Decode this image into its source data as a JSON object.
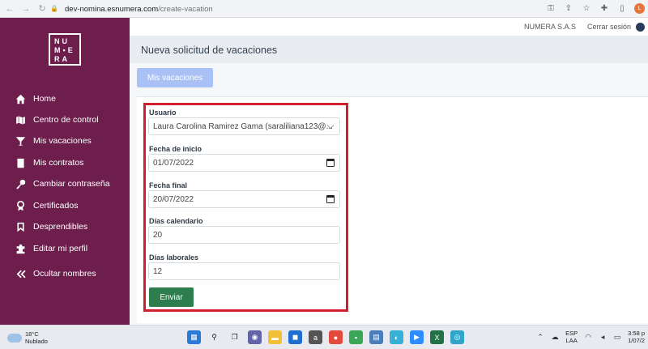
{
  "browser": {
    "url_host": "dev-nomina.esnumera.com",
    "url_path": "/create-vacation",
    "profile_initial": "L"
  },
  "sidebar": {
    "logo": [
      "NU",
      "M▪E",
      "RA"
    ],
    "items": [
      {
        "label": "Home",
        "icon": "home-icon"
      },
      {
        "label": "Centro de control",
        "icon": "map-icon"
      },
      {
        "label": "Mis vacaciones",
        "icon": "cocktail-icon"
      },
      {
        "label": "Mis contratos",
        "icon": "book-icon"
      },
      {
        "label": "Cambiar contraseña",
        "icon": "key-icon"
      },
      {
        "label": "Certificados",
        "icon": "award-icon"
      },
      {
        "label": "Desprendibles",
        "icon": "bookmark-icon"
      },
      {
        "label": "Editar mi perfil",
        "icon": "puzzle-icon"
      },
      {
        "label": "Ocultar nombres",
        "icon": "double-chevron-left-icon"
      }
    ]
  },
  "topbar": {
    "company": "NUMERA S.A.S",
    "logout": "Cerrar sesión"
  },
  "page": {
    "title": "Nueva solicitud de vacaciones",
    "tab": "Mis vacaciones"
  },
  "form": {
    "user_label": "Usuario",
    "user_value": "Laura Carolina Ramirez Gama (saraliliana123@...",
    "start_label": "Fecha de inicio",
    "start_value": "01/07/2022",
    "end_label": "Fecha final",
    "end_value": "20/07/2022",
    "cal_days_label": "Días calendario",
    "cal_days_value": "20",
    "work_days_label": "Días laborales",
    "work_days_value": "12",
    "submit_label": "Enviar"
  },
  "taskbar": {
    "temp": "18°C",
    "weather": "Nublado",
    "lang_1": "ESP",
    "lang_2": "LAA",
    "time": "3:58 p",
    "date": "1/07/2"
  },
  "colors": {
    "sidebar": "#6d1e4d",
    "highlight": "#d1202b",
    "submit": "#2e7d4f",
    "tab": "#a9c1f5"
  }
}
